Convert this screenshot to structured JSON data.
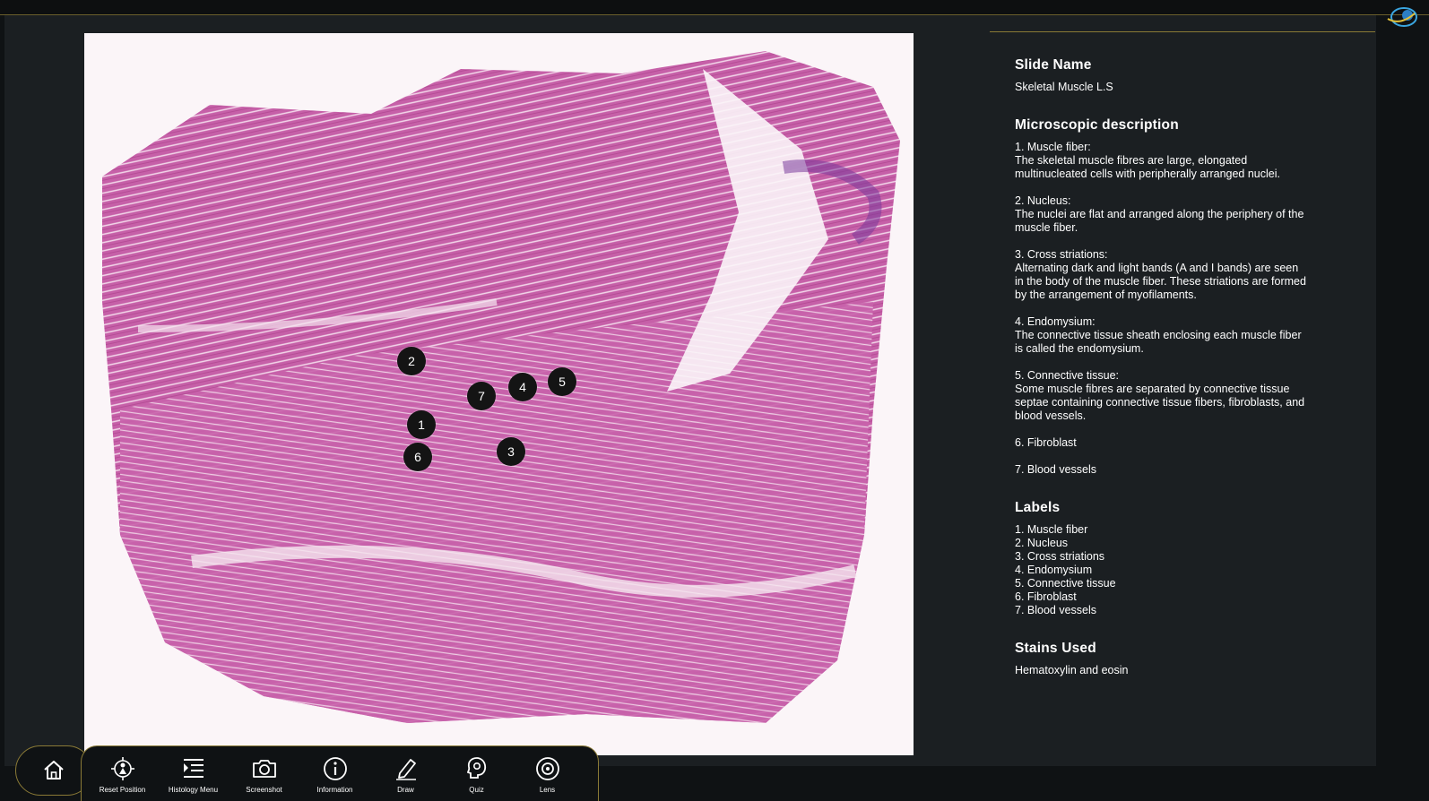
{
  "info": {
    "slide_name_heading": "Slide Name",
    "slide_name": "Skeletal Muscle L.S",
    "micro_heading": "Microscopic description",
    "micro_items": [
      "1. Muscle fiber:\nThe skeletal muscle fibres are large, elongated\nmultinucleated cells with peripherally arranged nuclei.",
      "2. Nucleus:\nThe nuclei are flat and arranged along the periphery of the\nmuscle fiber.",
      "3. Cross striations:\nAlternating dark and light bands (A and I bands) are seen\nin the body of the muscle fiber. These striations are formed\nby the arrangement of myofilaments.",
      "4. Endomysium:\nThe connective tissue sheath enclosing each muscle fiber\nis called the endomysium.",
      "5. Connective tissue:\nSome muscle fibres are separated by connective tissue\nseptae containing connective tissue fibers, fibroblasts, and\nblood vessels.",
      "6. Fibroblast",
      "7. Blood vessels"
    ],
    "labels_heading": "Labels",
    "labels": [
      "1. Muscle fiber",
      "2. Nucleus",
      "3. Cross striations",
      "4. Endomysium",
      "5. Connective tissue",
      "6. Fibroblast",
      "7. Blood vessels"
    ],
    "stains_heading": "Stains Used",
    "stains": "Hematoxylin and eosin"
  },
  "markers": [
    "1",
    "2",
    "3",
    "4",
    "5",
    "6",
    "7"
  ],
  "toolbar": {
    "items": [
      {
        "label": "Reset Position",
        "icon": "reset-position-icon"
      },
      {
        "label": "Histology Menu",
        "icon": "menu-list-icon"
      },
      {
        "label": "Screenshot",
        "icon": "camera-icon"
      },
      {
        "label": "Information",
        "icon": "info-icon"
      },
      {
        "label": "Draw",
        "icon": "pen-icon"
      },
      {
        "label": "Quiz",
        "icon": "quiz-icon"
      },
      {
        "label": "Lens",
        "icon": "lens-icon"
      }
    ]
  },
  "colors": {
    "accent": "#8a7a36",
    "panel": "#1b1f22",
    "tissue": "#c65aa6"
  }
}
